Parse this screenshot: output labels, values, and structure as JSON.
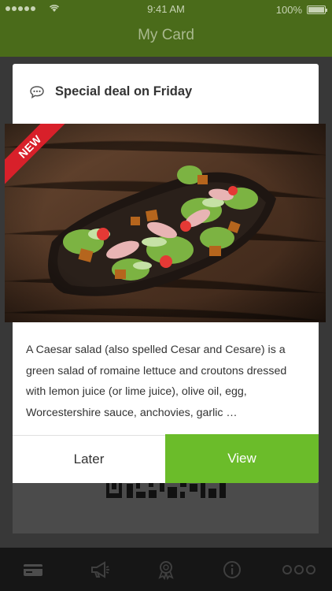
{
  "status_bar": {
    "time": "9:41 AM",
    "battery": "100%"
  },
  "nav": {
    "title": "My Card"
  },
  "modal": {
    "title": "Special deal on Friday",
    "header_icon": "chat-bubble-icon",
    "badge": "NEW",
    "description": "A Caesar salad (also spelled Cesar and Cesare) is a green salad of romaine lettuce and croutons dressed with lemon juice (or lime juice), olive oil, egg, Worcestershire sauce, anchovies, garlic …",
    "later_label": "Later",
    "view_label": "View"
  },
  "tabs": [
    {
      "icon": "card-icon"
    },
    {
      "icon": "megaphone-icon"
    },
    {
      "icon": "award-icon"
    },
    {
      "icon": "info-icon"
    },
    {
      "icon": "more-icon"
    }
  ],
  "colors": {
    "brand_green": "#6bbc2a",
    "nav_green_dimmed": "#4a6b1a",
    "badge_red": "#d8202a"
  }
}
